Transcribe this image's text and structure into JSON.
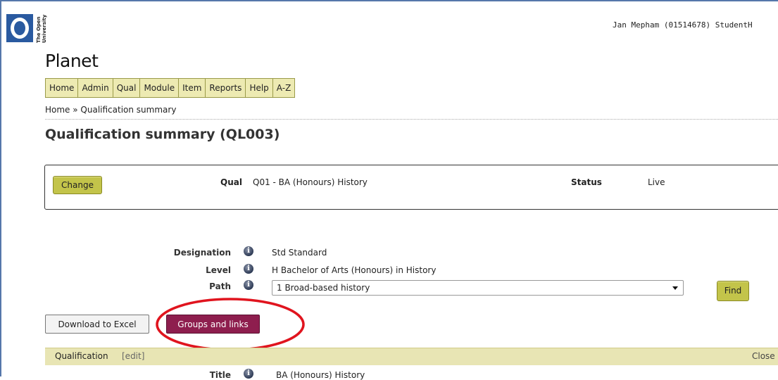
{
  "branding": {
    "logo_text": "The Open University",
    "app_title": "Planet"
  },
  "header": {
    "user_info": "Jan Mepham (01514678)  StudentH"
  },
  "nav": {
    "tabs": [
      "Home",
      "Admin",
      "Qual",
      "Module",
      "Item",
      "Reports",
      "Help",
      "A-Z"
    ]
  },
  "breadcrumb": "Home » Qualification summary",
  "page_title": "Qualification summary (QL003)",
  "summary": {
    "change_label": "Change",
    "qual_label": "Qual",
    "qual_value": "Q01 - BA (Honours) History",
    "status_label": "Status",
    "status_value": "Live"
  },
  "details": {
    "designation_label": "Designation",
    "designation_value": "Std Standard",
    "level_label": "Level",
    "level_value": "H Bachelor of Arts (Honours) in History",
    "path_label": "Path",
    "path_value": "1 Broad-based history",
    "find_label": "Find"
  },
  "actions": {
    "excel_label": "Download to Excel",
    "groups_label": "Groups and links"
  },
  "section": {
    "title": "Qualification",
    "edit_label": "[edit]",
    "close_label": "Close",
    "title_field_label": "Title",
    "title_field_value": "BA (Honours) History"
  },
  "icons": {
    "info": "info-icon",
    "dropdown": "chevron-down-icon"
  },
  "colors": {
    "nav_tab_bg": "#edeab2",
    "olive_button": "#c3c44a",
    "groups_button": "#8e1e4e",
    "annotation": "#e0141e",
    "section_bar": "#e8e5b4"
  }
}
